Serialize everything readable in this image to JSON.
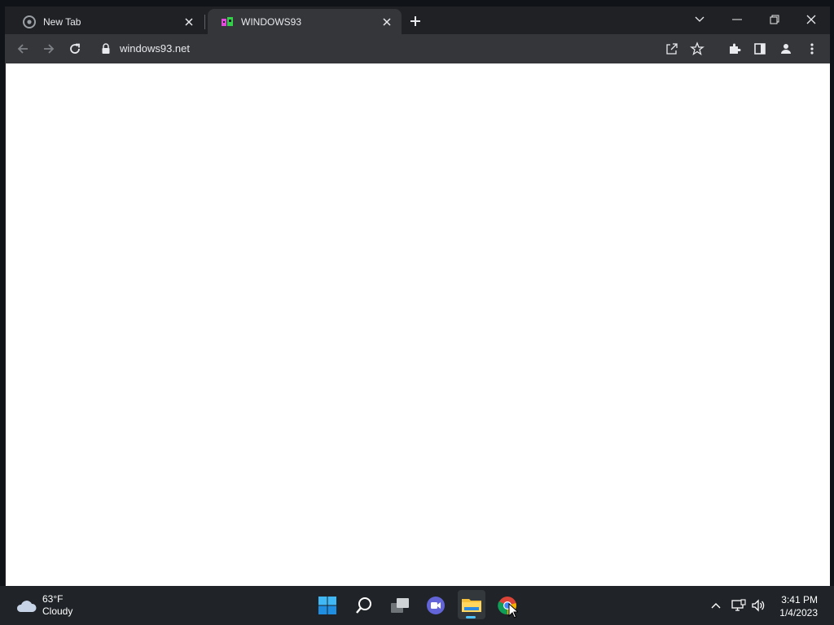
{
  "browser": {
    "tabs": [
      {
        "title": "New Tab",
        "icon": "chrome-icon",
        "active": false
      },
      {
        "title": "WINDOWS93",
        "icon": "windows93-favicon",
        "active": true
      }
    ],
    "address": {
      "url": "windows93.net"
    },
    "colors": {
      "frame": "#202124",
      "toolbar": "#35363a",
      "text": "#e8eaed"
    }
  },
  "taskbar": {
    "weather": {
      "temperature": "63°F",
      "condition": "Cloudy"
    },
    "apps": [
      "start-icon",
      "search-icon",
      "task-view-icon",
      "teams-chat-icon",
      "file-explorer-icon",
      "chrome-icon"
    ],
    "clock": {
      "time": "3:41 PM",
      "date": "1/4/2023"
    },
    "colors": {
      "background": "#202428",
      "accent": "#4cc2ff"
    }
  }
}
